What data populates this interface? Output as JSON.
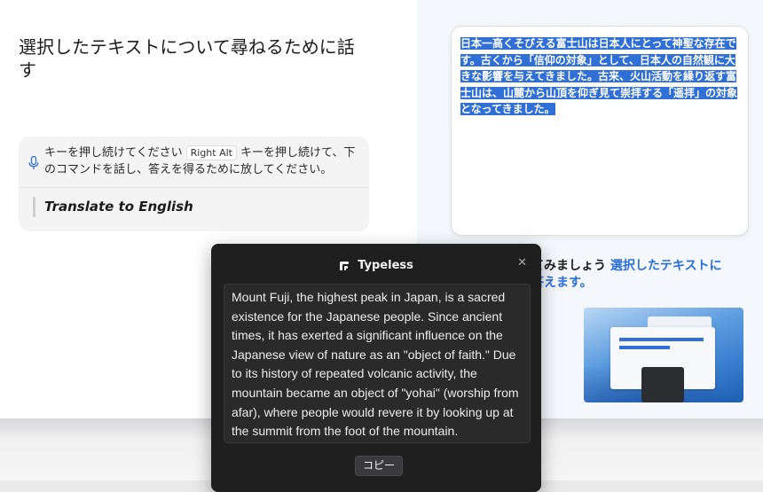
{
  "guide": {
    "title": "選択したテキストについて尋ねるために話す",
    "instruction_part1": "キーを押し続けてください",
    "key_label": "Right Alt",
    "instruction_part2": "キーを押し続けて、下のコマンドを話し、答えを得るために放してください。",
    "command": "Translate to English"
  },
  "editor": {
    "selected_text": "日本一高くそびえる富士山は日本人にとって神聖な存在です。古くから「信仰の対象」として、日本人の自然観に大きな影響を与えてきました。古来、火山活動を繰り返す富士山は、山麓から山頂を仰ぎ見て崇拝する「遥拝」の対象となってきました。"
  },
  "try_hint": {
    "partial_text": "てみましょう",
    "highlight_line1": "選択したテキストに",
    "highlight_line2": "答えます。"
  },
  "dialog": {
    "app_name": "Typeless",
    "close_icon": "close-icon",
    "result_text": "Mount Fuji, the highest peak in Japan, is a sacred existence for the Japanese people. Since ancient times, it has exerted a significant influence on the Japanese view of nature as an \"object of faith.\" Due to its history of repeated volcanic activity, the mountain became an object of \"yohai\" (worship from afar), where people would revere it by looking up at the summit from the foot of the mountain.",
    "copy_label": "コピー"
  },
  "colors": {
    "accent": "#2f6fd6",
    "hint_blue": "#2a6ee0",
    "dialog_bg": "#1f1f20"
  }
}
